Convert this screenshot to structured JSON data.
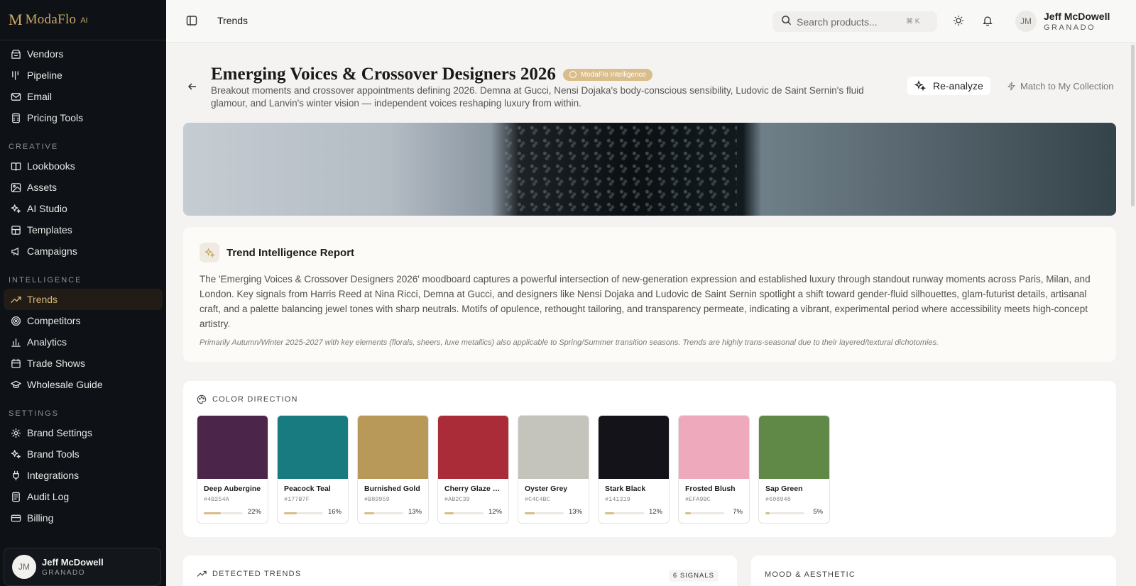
{
  "brand": {
    "name": "ModaFlo",
    "suffix": "AI"
  },
  "sidebar": {
    "top_items": [
      {
        "label": "Vendors",
        "icon": "vendors-icon"
      },
      {
        "label": "Pipeline",
        "icon": "pipeline-icon"
      },
      {
        "label": "Email",
        "icon": "mail-icon"
      },
      {
        "label": "Pricing Tools",
        "icon": "calculator-icon"
      }
    ],
    "sections": [
      {
        "label": "CREATIVE",
        "items": [
          {
            "label": "Lookbooks",
            "icon": "book-open-icon"
          },
          {
            "label": "Assets",
            "icon": "image-icon"
          },
          {
            "label": "AI Studio",
            "icon": "sparkles-icon"
          },
          {
            "label": "Templates",
            "icon": "layout-icon"
          },
          {
            "label": "Campaigns",
            "icon": "megaphone-icon"
          }
        ]
      },
      {
        "label": "INTELLIGENCE",
        "items": [
          {
            "label": "Trends",
            "icon": "trending-up-icon",
            "active": true
          },
          {
            "label": "Competitors",
            "icon": "target-icon"
          },
          {
            "label": "Analytics",
            "icon": "bar-chart-icon"
          },
          {
            "label": "Trade Shows",
            "icon": "calendar-icon"
          },
          {
            "label": "Wholesale Guide",
            "icon": "graduation-cap-icon"
          }
        ]
      },
      {
        "label": "SETTINGS",
        "items": [
          {
            "label": "Brand Settings",
            "icon": "settings-icon"
          },
          {
            "label": "Brand Tools",
            "icon": "sparkles-icon"
          },
          {
            "label": "Integrations",
            "icon": "plug-icon"
          },
          {
            "label": "Audit Log",
            "icon": "log-icon"
          },
          {
            "label": "Billing",
            "icon": "credit-card-icon"
          }
        ]
      }
    ],
    "user": {
      "initials": "JM",
      "name": "Jeff McDowell",
      "org": "GRANADO"
    }
  },
  "topbar": {
    "breadcrumb": "Trends",
    "search_placeholder": "Search products...",
    "search_shortcut": "⌘ K",
    "user": {
      "initials": "JM",
      "name": "Jeff McDowell",
      "org": "GRANADO"
    }
  },
  "header": {
    "title": "Emerging Voices & Crossover Designers 2026",
    "badge": "ModaFlo Intelligence",
    "subtitle": "Breakout moments and crossover appointments defining 2026. Demna at Gucci, Nensi Dojaka's body-conscious sensibility, Ludovic de Saint Sernin's fluid glamour, and Lanvin's winter vision — independent voices reshaping luxury from within.",
    "reanalyze_label": "Re-analyze",
    "match_label": "Match to My Collection"
  },
  "report": {
    "title": "Trend Intelligence Report",
    "body": "The 'Emerging Voices & Crossover Designers 2026' moodboard captures a powerful intersection of new-generation expression and established luxury through standout runway moments across Paris, Milan, and London. Key signals from Harris Reed at Nina Ricci, Demna at Gucci, and designers like Nensi Dojaka and Ludovic de Saint Sernin spotlight a shift toward gender-fluid silhouettes, glam-futurist details, artisanal craft, and a palette balancing jewel tones with sharp neutrals. Motifs of opulence, rethought tailoring, and transparency permeate, indicating a vibrant, experimental period where accessibility meets high-concept artistry.",
    "note": "Primarily Autumn/Winter 2025-2027 with key elements (florals, sheers, luxe metallics) also applicable to Spring/Summer transition seasons. Trends are highly trans-seasonal due to their layered/textural dichotomies."
  },
  "color_direction": {
    "label": "COLOR DIRECTION",
    "swatches": [
      {
        "name": "Deep Aubergine",
        "hex": "#4B254A",
        "pct": "22%",
        "share": 0.22
      },
      {
        "name": "Peacock Teal",
        "hex": "#177B7F",
        "pct": "16%",
        "share": 0.16
      },
      {
        "name": "Burnished Gold",
        "hex": "#B89959",
        "pct": "13%",
        "share": 0.13
      },
      {
        "name": "Cherry Glaze Red",
        "hex": "#AB2C39",
        "pct": "12%",
        "share": 0.12
      },
      {
        "name": "Oyster Grey",
        "hex": "#C4C4BC",
        "pct": "13%",
        "share": 0.13
      },
      {
        "name": "Stark Black",
        "hex": "#141319",
        "pct": "12%",
        "share": 0.12
      },
      {
        "name": "Frosted Blush",
        "hex": "#EFA9BC",
        "pct": "7%",
        "share": 0.07
      },
      {
        "name": "Sap Green",
        "hex": "#608948",
        "pct": "5%",
        "share": 0.05
      }
    ]
  },
  "detected_trends": {
    "label": "DETECTED TRENDS",
    "count": "6 SIGNALS"
  },
  "mood": {
    "label": "MOOD & AESTHETIC"
  },
  "colors": {
    "accent": "#C9A768",
    "sidebar_bg": "#0E1115"
  }
}
